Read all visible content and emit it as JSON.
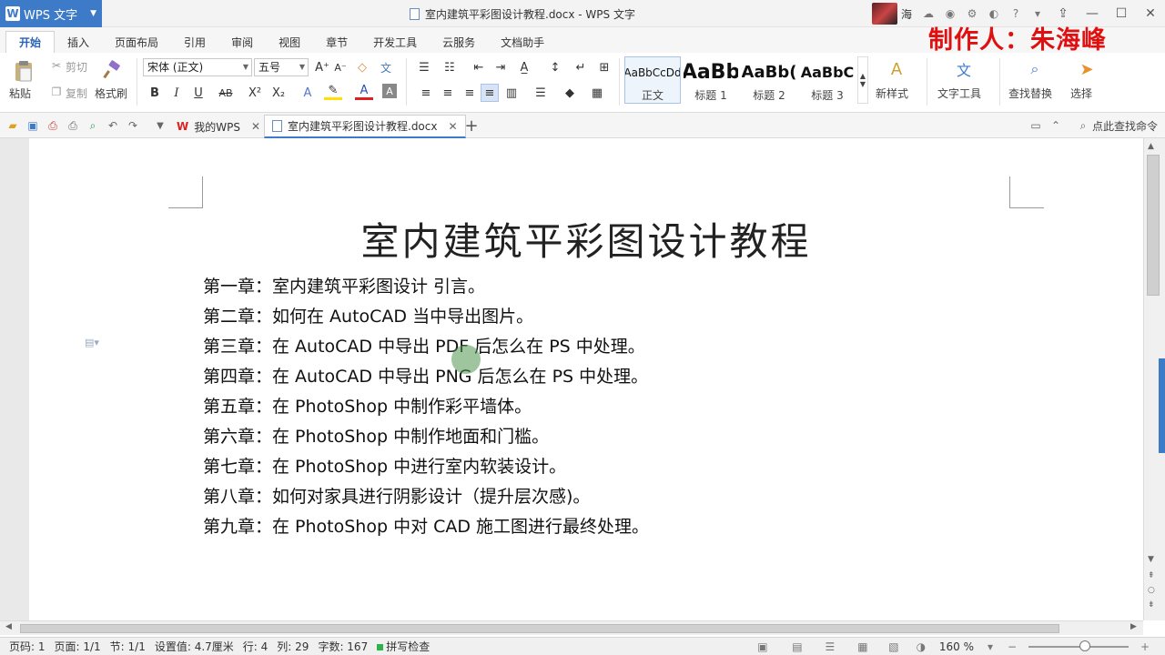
{
  "app": {
    "name": "WPS 文字",
    "window_title": "室内建筑平彩图设计教程.docx - WPS 文字",
    "user": "海"
  },
  "watermark": "制作人：朱海峰",
  "menu": [
    "开始",
    "插入",
    "页面布局",
    "引用",
    "审阅",
    "视图",
    "章节",
    "开发工具",
    "云服务",
    "文档助手"
  ],
  "ribbon": {
    "paste": "粘贴",
    "cut": "剪切",
    "copy": "复制",
    "format_painter": "格式刷",
    "font": "宋体 (正文)",
    "font_size": "五号",
    "styles": [
      {
        "sample": "AaBbCcDd",
        "name": "正文"
      },
      {
        "sample": "AaBb",
        "name": "标题 1"
      },
      {
        "sample": "AaBb(",
        "name": "标题 2"
      },
      {
        "sample": "AaBbC",
        "name": "标题 3"
      }
    ],
    "new_style": "新样式",
    "text_tools": "文字工具",
    "find_replace": "查找替换",
    "select": "选择"
  },
  "tabs": {
    "home": "我的WPS",
    "document": "室内建筑平彩图设计教程.docx",
    "search_cmd": "点此查找命令"
  },
  "document": {
    "title": "室内建筑平彩图设计教程",
    "chapters": [
      "第一章：室内建筑平彩图设计 引言。",
      "第二章：如何在 AutoCAD 当中导出图片。",
      "第三章：在 AutoCAD 中导出 PDF 后怎么在 PS 中处理。",
      "第四章：在 AutoCAD 中导出 PNG 后怎么在 PS 中处理。",
      "第五章：在 PhotoShop 中制作彩平墙体。",
      "第六章：在 PhotoShop 中制作地面和门槛。",
      "第七章：在 PhotoShop 中进行室内软装设计。",
      "第八章：如何对家具进行阴影设计（提升层次感)。",
      "第九章：在 PhotoShop 中对 CAD 施工图进行最终处理。"
    ]
  },
  "status": {
    "page_no": "页码: 1",
    "pages": "页面: 1/1",
    "section": "节: 1/1",
    "setting": "设置值: 4.7厘米",
    "row": "行: 4",
    "col": "列: 29",
    "words": "字数: 167",
    "spell": "拼写检查",
    "zoom": "160 %"
  },
  "colors": {
    "accent": "#3d7bc8",
    "watermark": "#e01010"
  }
}
